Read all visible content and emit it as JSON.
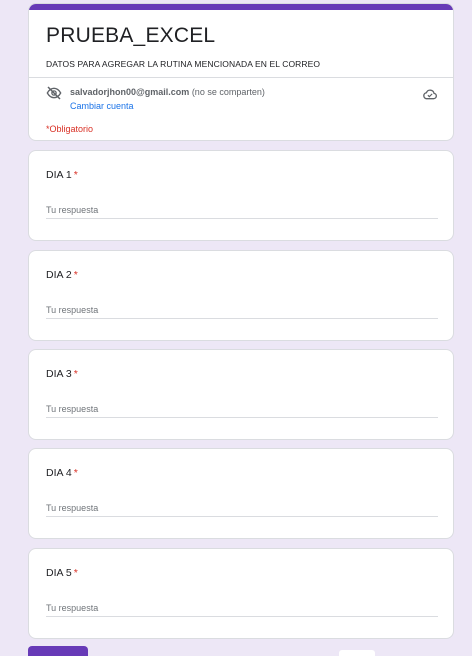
{
  "form": {
    "title": "PRUEBA_EXCEL",
    "description": "DATOS PARA AGREGAR LA RUTINA MENCIONADA EN EL CORREO",
    "theme_color": "#673ab7",
    "background_color": "#ede7f6"
  },
  "account": {
    "email": "salvadorjhon00@gmail.com",
    "note": " (no se comparten)",
    "switch_label": "Cambiar cuenta",
    "visibility_icon": "eye-off-icon",
    "save_icon": "cloud-check-icon"
  },
  "required_note": "*Obligatorio",
  "questions": [
    {
      "label": "DIA 1",
      "required_mark": "*",
      "placeholder": "Tu respuesta"
    },
    {
      "label": "DIA 2",
      "required_mark": "*",
      "placeholder": "Tu respuesta"
    },
    {
      "label": "DIA 3",
      "required_mark": "*",
      "placeholder": "Tu respuesta"
    },
    {
      "label": "DIA 4",
      "required_mark": "*",
      "placeholder": "Tu respuesta"
    },
    {
      "label": "DIA 5",
      "required_mark": "*",
      "placeholder": "Tu respuesta"
    }
  ]
}
